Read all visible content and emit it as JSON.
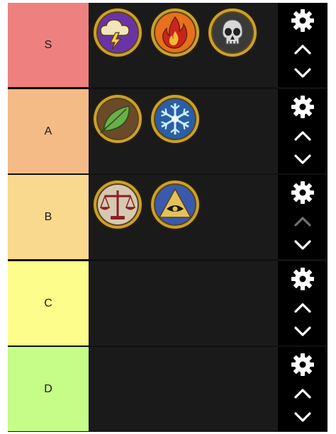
{
  "tiers": [
    {
      "label": "S",
      "color": "#ee8080",
      "up_enabled": true,
      "down_enabled": true,
      "items": [
        {
          "icon": "storm-cloud-icon",
          "bg": "#6a34a8"
        },
        {
          "icon": "flame-icon",
          "bg": "#e8701a"
        },
        {
          "icon": "skull-icon",
          "bg": "#3a3a3a"
        }
      ]
    },
    {
      "label": "A",
      "color": "#f4bb87",
      "up_enabled": true,
      "down_enabled": true,
      "items": [
        {
          "icon": "leaf-icon",
          "bg": "#6b4a2a"
        },
        {
          "icon": "snowflake-icon",
          "bg": "#2a5ea6"
        }
      ]
    },
    {
      "label": "B",
      "color": "#f8d98d",
      "up_enabled": false,
      "down_enabled": true,
      "items": [
        {
          "icon": "scales-icon",
          "bg": "#d6c8b4"
        },
        {
          "icon": "eye-pyramid-icon",
          "bg": "#3a5ab0"
        }
      ]
    },
    {
      "label": "C",
      "color": "#fcfd8a",
      "up_enabled": true,
      "down_enabled": true,
      "items": []
    },
    {
      "label": "D",
      "color": "#c6fc88",
      "up_enabled": true,
      "down_enabled": true,
      "items": []
    }
  ],
  "colors": {
    "control_bg": "#000000",
    "control_fg": "#ffffff",
    "control_disabled": "#6f6f6f",
    "item_area_bg": "#1a1a1a",
    "gold_border": "#c9a030"
  }
}
